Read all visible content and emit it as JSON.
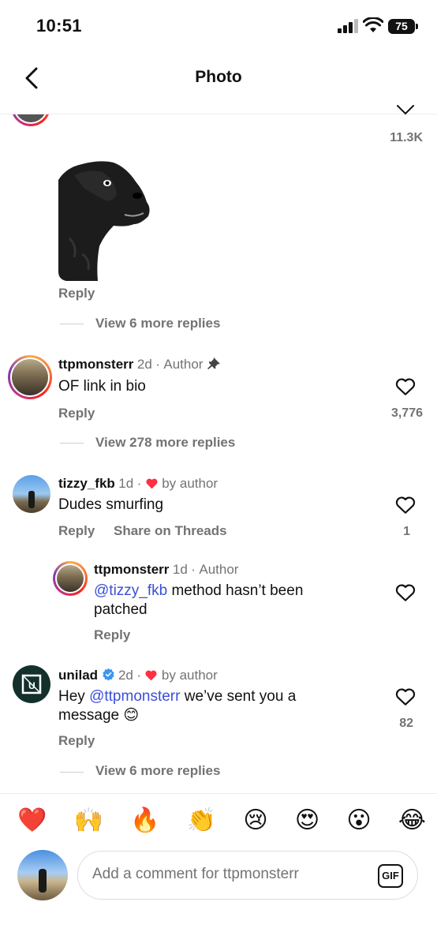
{
  "status_bar": {
    "time": "10:51",
    "battery": "75"
  },
  "header": {
    "title": "Photo"
  },
  "top_comment": {
    "likes": "11.3K",
    "reply": "Reply",
    "view_more": "View 6 more replies"
  },
  "comments": [
    {
      "user": "ttpmonsterr",
      "time": "2d",
      "sep": "·",
      "tag": "Author",
      "text": "OF link in bio",
      "reply": "Reply",
      "likes": "3,776",
      "view_more": "View 278 more replies"
    },
    {
      "user": "tizzy_fkb",
      "time": "1d",
      "sep": "·",
      "tag": "by author",
      "text": "Dudes smurfing",
      "reply": "Reply",
      "share": "Share on Threads",
      "likes": "1"
    },
    {
      "user": "ttpmonsterr",
      "time": "1d",
      "sep": "·",
      "tag": "Author",
      "mention": "@tizzy_fkb",
      "text": " method hasn’t been patched",
      "reply": "Reply"
    },
    {
      "user": "unilad",
      "time": "2d",
      "sep": "·",
      "tag": "by author",
      "text_a": "Hey ",
      "mention": "@ttpmonsterr",
      "text_b": " we’ve sent you a message 😊",
      "reply": "Reply",
      "likes": "82",
      "view_more": "View 6 more replies"
    }
  ],
  "reactions": [
    "❤️",
    "🙌",
    "🔥",
    "👏",
    "😢",
    "😍",
    "😮",
    "😂"
  ],
  "composer": {
    "placeholder": "Add a comment for ttpmonsterr",
    "gif": "GIF"
  },
  "colors": {
    "heart": "#ff3040",
    "mention": "#3a4fd8",
    "verified": "#3897f0"
  }
}
